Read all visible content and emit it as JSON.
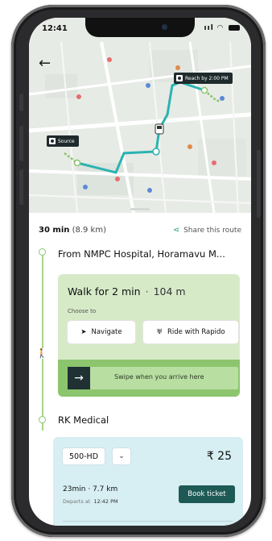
{
  "status_bar": {
    "time": "12:41",
    "signal": "ııl"
  },
  "map": {
    "reach_tag": "Reach by 2:00 PM",
    "source_tag": "Source",
    "route_color": "#2bb3b1",
    "walk_color": "#8cc56e"
  },
  "summary": {
    "duration": "30 min",
    "distance": "(8.9 km)",
    "share_label": "Share this route"
  },
  "from_stop": {
    "title": "From NMPC Hospital, Horamavu M..."
  },
  "walk_step": {
    "title": "Walk for 2 min",
    "separator": "·",
    "distance": "104 m",
    "choose_label": "Choose to",
    "navigate_label": "Navigate",
    "rapido_label": "Ride with Rapido",
    "swipe_label": "Swipe when you arrive here"
  },
  "next_stop": {
    "title": "RK Medical"
  },
  "bus_step": {
    "route": "500-HD",
    "fare": "₹ 25",
    "ride_time": "23min",
    "ride_separator": "·",
    "ride_distance": "7.7 km",
    "departs_label": "Departs at",
    "departs_time": "12:42 PM",
    "book_label": "Book ticket"
  },
  "colors": {
    "walk_card_bg": "#d6eac8",
    "swipe_bar": "#8cc56e",
    "bus_card_bg": "#d7eef2",
    "book_button": "#1e5a55"
  }
}
